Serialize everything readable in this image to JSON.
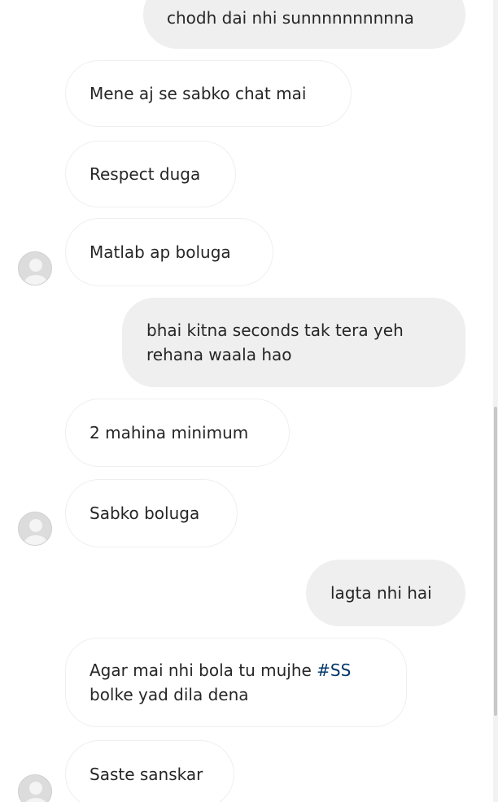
{
  "messages": [
    {
      "direction": "outgoing",
      "text": "chodh dai nhi sunnnnnnnnnna"
    },
    {
      "direction": "incoming",
      "text": "Mene aj se sabko chat mai"
    },
    {
      "direction": "incoming",
      "text": "Respect duga"
    },
    {
      "direction": "incoming",
      "text": "Matlab ap boluga"
    },
    {
      "direction": "outgoing",
      "line1": "bhai kitna seconds tak tera yeh",
      "line2": "rehana waala hao"
    },
    {
      "direction": "incoming",
      "text": "2 mahina minimum"
    },
    {
      "direction": "incoming",
      "text": "Sabko boluga"
    },
    {
      "direction": "outgoing",
      "text": "lagta nhi hai"
    },
    {
      "direction": "incoming",
      "line1_prefix": "Agar mai nhi bola tu mujhe ",
      "hashtag": "#SS",
      "line2": "bolke yad dila dena"
    },
    {
      "direction": "incoming",
      "text": "Saste sanskar"
    }
  ],
  "colors": {
    "incoming_bubble_bg": "#ffffff",
    "incoming_bubble_border": "#efefef",
    "outgoing_bubble_bg": "#efefef",
    "text": "#262626",
    "hashtag": "#00376b",
    "avatar_placeholder": "#d9d9d9"
  },
  "icons": {
    "avatar": "default-profile-avatar-icon"
  }
}
